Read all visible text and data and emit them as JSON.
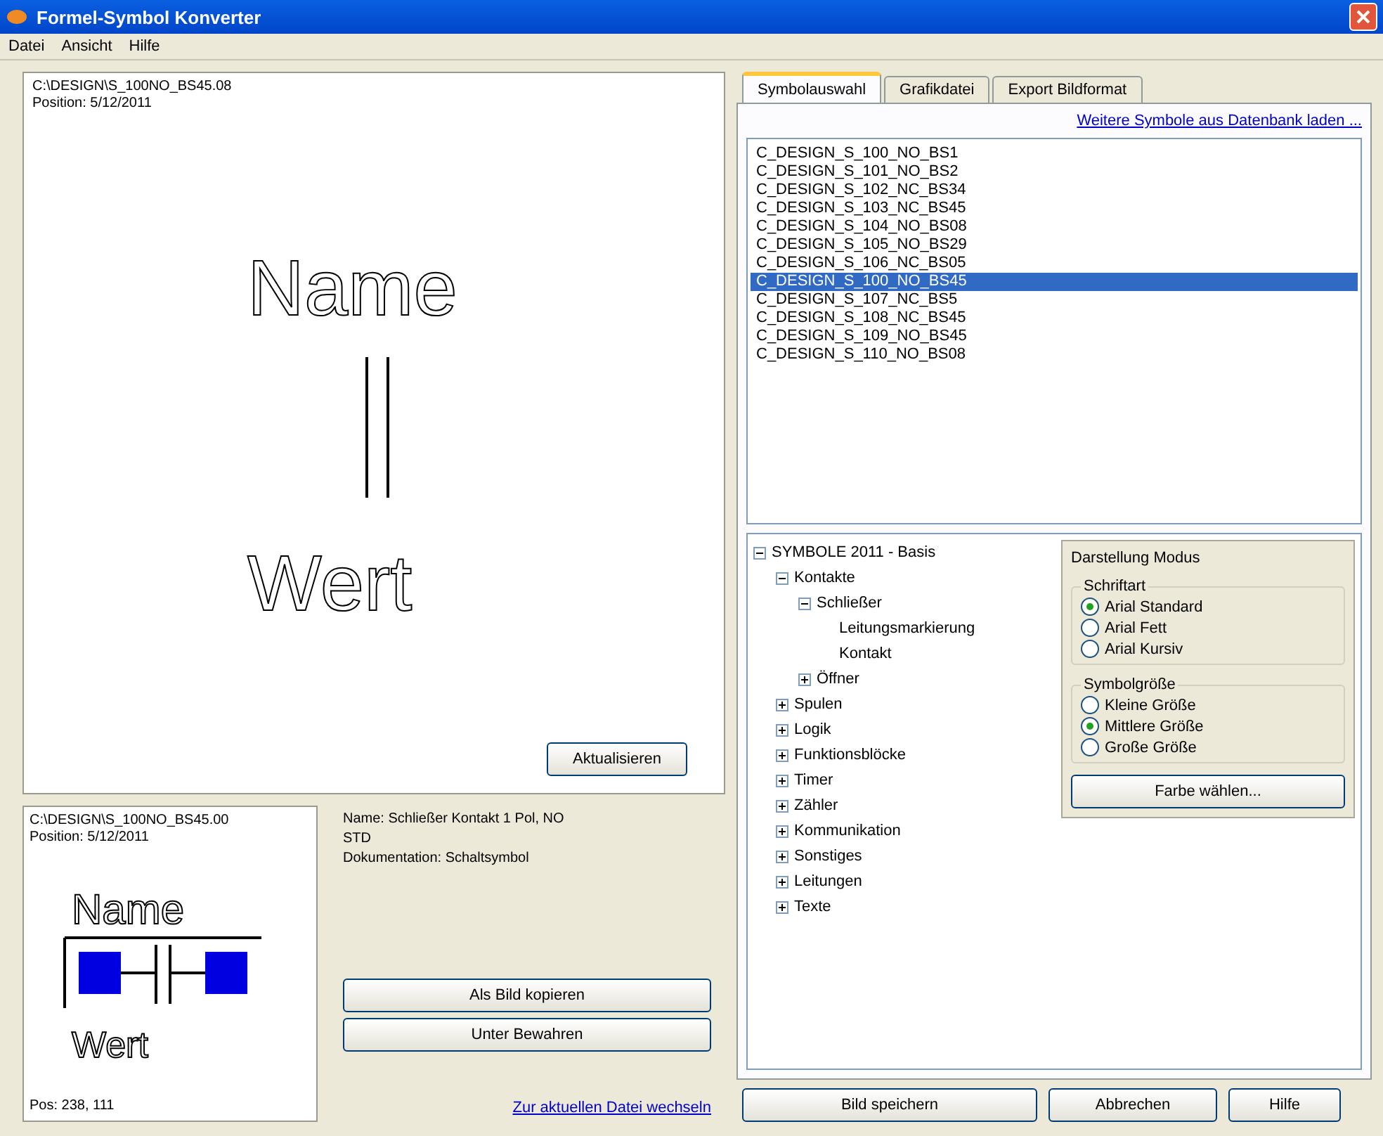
{
  "window": {
    "title": "Formel-Symbol Konverter"
  },
  "menu": [
    "Datei",
    "Ansicht",
    "Hilfe"
  ],
  "preview": {
    "path": "C:\\DESIGN\\S_100NO_BS45.08",
    "position": "Position: 5/12/2011",
    "symbol_name": "Name",
    "symbol_value": "Wert",
    "button": "Aktualisieren"
  },
  "thumbnail": {
    "path": "C:\\DESIGN\\S_100NO_BS45.00",
    "position": "Position: 5/12/2011",
    "symbol_name": "Name",
    "symbol_value": "Wert",
    "coords": "Pos: 238, 111"
  },
  "info": {
    "lines": [
      "Name: Schließer Kontakt 1 Pol, NO",
      "STD",
      "Dokumentation: Schaltsymbol"
    ],
    "buttons": [
      "Als Bild kopieren",
      "Unter Bewahren"
    ],
    "link": "Zur aktuellen Datei wechseln"
  },
  "tabs": [
    {
      "label": "Symbolauswahl",
      "selected": true
    },
    {
      "label": "Grafikdatei",
      "selected": false
    },
    {
      "label": "Export Bildformat",
      "selected": false
    }
  ],
  "link": "Weitere Symbole aus Datenbank laden ...",
  "files": [
    {
      "label": "C_DESIGN_S_100_NO_BS1",
      "selected": false
    },
    {
      "label": "C_DESIGN_S_101_NO_BS2",
      "selected": false
    },
    {
      "label": "C_DESIGN_S_102_NC_BS34",
      "selected": false
    },
    {
      "label": "C_DESIGN_S_103_NC_BS45",
      "selected": false
    },
    {
      "label": "C_DESIGN_S_104_NO_BS08",
      "selected": false
    },
    {
      "label": "C_DESIGN_S_105_NO_BS29",
      "selected": false
    },
    {
      "label": "C_DESIGN_S_106_NC_BS05",
      "selected": false
    },
    {
      "label": "C_DESIGN_S_100_NO_BS45",
      "selected": true
    },
    {
      "label": "C_DESIGN_S_107_NC_BS5",
      "selected": false
    },
    {
      "label": "C_DESIGN_S_108_NC_BS45",
      "selected": false
    },
    {
      "label": "C_DESIGN_S_109_NO_BS45",
      "selected": false
    },
    {
      "label": "C_DESIGN_S_110_NO_BS08",
      "selected": false
    }
  ],
  "tree": [
    {
      "label": "SYMBOLE 2011 - Basis",
      "expanded": true,
      "children": [
        {
          "label": "Kontakte",
          "expanded": true,
          "children": [
            {
              "label": "Schließer",
              "expanded": true,
              "children": [
                {
                  "label": "Leitungsmarkierung"
                },
                {
                  "label": "Kontakt"
                }
              ]
            },
            {
              "label": "Öffner",
              "expanded": false
            }
          ]
        },
        {
          "label": "Spulen",
          "expanded": false
        },
        {
          "label": "Logik",
          "expanded": false
        },
        {
          "label": "Funktionsblöcke",
          "expanded": false
        },
        {
          "label": "Timer",
          "expanded": false
        },
        {
          "label": "Zähler",
          "expanded": false
        },
        {
          "label": "Kommunikation",
          "expanded": false
        },
        {
          "label": "Sonstiges",
          "expanded": false
        },
        {
          "label": "Leitungen",
          "expanded": false
        },
        {
          "label": "Texte",
          "expanded": false
        }
      ]
    }
  ],
  "options": {
    "title": "Darstellung Modus",
    "groups": [
      {
        "label": "Schriftart",
        "options": [
          {
            "label": "Arial Standard",
            "selected": true
          },
          {
            "label": "Arial Fett",
            "selected": false
          },
          {
            "label": "Arial Kursiv",
            "selected": false
          }
        ]
      },
      {
        "label": "Symbolgröße",
        "options": [
          {
            "label": "Kleine Größe",
            "selected": false
          },
          {
            "label": "Mittlere Größe",
            "selected": true
          },
          {
            "label": "Große Größe",
            "selected": false
          }
        ]
      }
    ],
    "button": "Farbe wählen..."
  },
  "footer_buttons": [
    "Bild speichern",
    "Abbrechen",
    "Hilfe"
  ]
}
